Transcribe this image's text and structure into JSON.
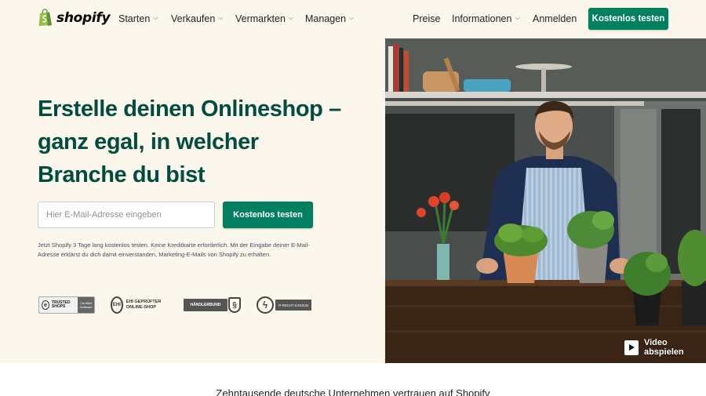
{
  "nav": {
    "logo_text": "shopify",
    "items": [
      {
        "label": "Starten"
      },
      {
        "label": "Verkaufen"
      },
      {
        "label": "Vermarkten"
      },
      {
        "label": "Managen"
      }
    ],
    "right": {
      "preise": "Preise",
      "informationen": "Informationen",
      "anmelden": "Anmelden",
      "cta": "Kostenlos testen"
    }
  },
  "hero": {
    "headline": "Erstelle deinen Onlineshop – ganz egal, in welcher Branche du bist",
    "email_placeholder": "Hier E-Mail-Adresse eingeben",
    "cta": "Kostenlos testen",
    "disclaimer": "Jetzt Shopify 3 Tage lang kostenlos testen. Keine Kreditkarte erforderlich. Mit der Eingabe deiner E-Mail-Adresse erklärst du dich damit einverstanden, Marketing-E-Mails von Shopify zu erhalten.",
    "video_label": "Video abspielen"
  },
  "badges": {
    "trusted_shops": {
      "text": "TRUSTED SHOPS",
      "right": "Certified Software"
    },
    "ehi": {
      "text": "EHI GEPRÜFTER ONLINE-SHOP"
    },
    "haendlerbund": {
      "text": "HÄNDLERBUND"
    },
    "it_recht": {
      "text": "IT-RECHT KANZLEI"
    }
  },
  "trust_line": "Zehntausende deutsche Unternehmen vertrauen auf Shopify",
  "colors": {
    "brand_green": "#008060",
    "headline_green": "#004c3f",
    "hero_bg": "#fbf7ed"
  }
}
